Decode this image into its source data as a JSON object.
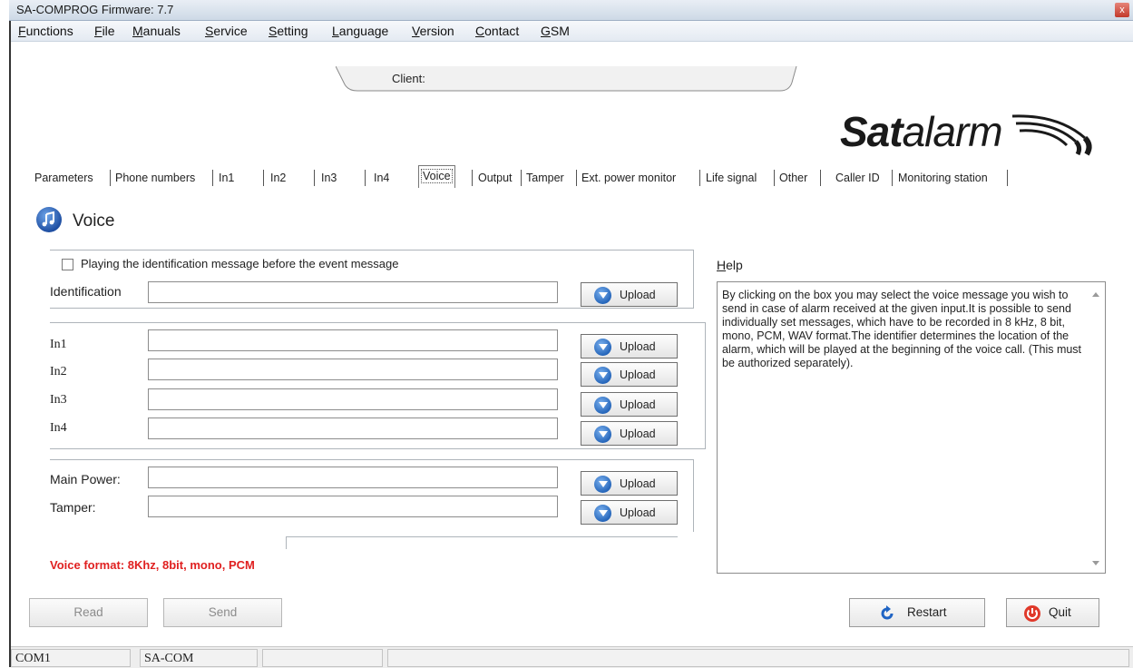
{
  "window": {
    "title": "SA-COMPROG Firmware: 7.7",
    "close_glyph": "x"
  },
  "menu": [
    {
      "first": "F",
      "rest": "unctions"
    },
    {
      "first": "F",
      "rest": "ile"
    },
    {
      "first": "M",
      "rest": "anuals"
    },
    {
      "first": "S",
      "rest": "ervice"
    },
    {
      "first": "S",
      "rest": "etting"
    },
    {
      "first": "L",
      "rest": "anguage"
    },
    {
      "first": "V",
      "rest": "ersion"
    },
    {
      "first": "C",
      "rest": "ontact"
    },
    {
      "first": "G",
      "rest": "SM"
    }
  ],
  "client": {
    "label": "Client:",
    "value": ""
  },
  "logo": {
    "bold": "Sat",
    "thin": "alarm"
  },
  "tabs": [
    "Parameters",
    "Phone numbers",
    "In1",
    "In2",
    "In3",
    "In4",
    "Voice",
    "Output",
    "Tamper",
    "Ext. power monitor",
    "Life signal",
    "Other",
    "Caller ID",
    "Monitoring station"
  ],
  "active_tab": "Voice",
  "voice": {
    "title": "Voice",
    "checkbox_label": "Playing the identification message before the event message",
    "checkbox_checked": false,
    "upload_label": "Upload",
    "fields": [
      {
        "label": "Identification",
        "value": ""
      },
      {
        "label": "In1",
        "value": ""
      },
      {
        "label": "In2",
        "value": ""
      },
      {
        "label": "In3",
        "value": ""
      },
      {
        "label": "In4",
        "value": ""
      },
      {
        "label": "Main Power:",
        "value": ""
      },
      {
        "label": "Tamper:",
        "value": ""
      }
    ],
    "format_note": "Voice format: 8Khz, 8bit, mono, PCM"
  },
  "help": {
    "label_first": "H",
    "label_rest": "elp",
    "text": "By clicking on the box you may select the voice message you wish to send in case of alarm received at the given input.It is possible to send individually set messages, which have to be recorded in 8 kHz, 8 bit, mono, PCM, WAV format.The identifier determines the location of the alarm, which will be played at the beginning of the voice call. (This must be authorized separately)."
  },
  "buttons": {
    "read": "Read",
    "send": "Send",
    "restart": "Restart",
    "quit": "Quit"
  },
  "status": {
    "port": "COM1",
    "device": "SA-COM",
    "cell3": "",
    "cell4": ""
  },
  "colors": {
    "accent_red": "#e02020",
    "icon_blue": "#2061b7"
  }
}
